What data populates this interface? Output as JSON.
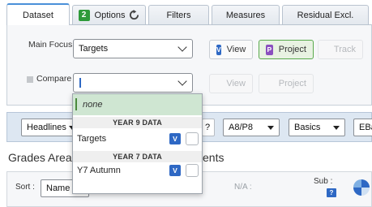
{
  "tabs": [
    {
      "label": "Dataset",
      "active": true
    },
    {
      "label": "Options",
      "badge": "2",
      "active": false
    },
    {
      "label": "Filters",
      "active": false
    },
    {
      "label": "Measures",
      "active": false
    },
    {
      "label": "Residual Excl.",
      "active": false
    }
  ],
  "main_focus": {
    "label": "Main Focus",
    "value": "Targets"
  },
  "compare": {
    "label": "Compare",
    "value": ""
  },
  "buttons": {
    "view": "View",
    "view_icon": "V",
    "project": "Project",
    "project_icon": "P",
    "track": "Track",
    "view2": "View",
    "project2": "Project"
  },
  "toolbar": {
    "headlines": "Headlines",
    "qmark": "?",
    "a8p8": "A8/P8",
    "basics": "Basics",
    "ebacc": "EBa"
  },
  "section_title": "Grades Area",
  "section_title_tail": "ents",
  "bottombar": {
    "sort_label": "Sort :",
    "sort_value": "Name",
    "na_label": "N/A :",
    "sub_label": "Sub :",
    "sub_q": "?"
  },
  "dropdown": {
    "none_label": "none",
    "groups": [
      {
        "header": "YEAR 9 DATA",
        "item": "Targets",
        "badge": "V"
      },
      {
        "header": "YEAR 7 DATA",
        "item": "Y7 Autumn",
        "badge": "V"
      }
    ]
  },
  "colors": {
    "accent_blue": "#2e68c4",
    "project_purple": "#8a4fbf",
    "active_green": "#5aaa4d",
    "badge_green": "#2e9a3a"
  }
}
